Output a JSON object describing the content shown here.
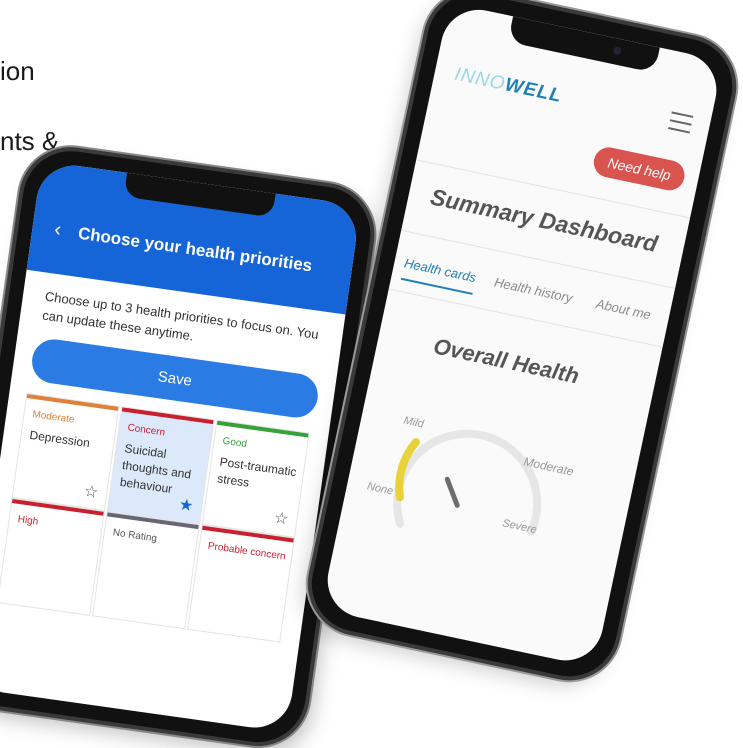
{
  "background": {
    "line1": "ion",
    "line2": "nts &"
  },
  "left_phone": {
    "header": {
      "back_icon": "chevron-left-icon",
      "title": "Choose your health priorities"
    },
    "description": "Choose up to 3 health priorities to focus on. You can update these anytime.",
    "save_label": "Save",
    "cards": [
      {
        "level": "Moderate",
        "name": "Depression",
        "starred": false
      },
      {
        "level": "Concern",
        "name": "Suicidal thoughts and behaviour",
        "starred": true
      },
      {
        "level": "Good",
        "name": "Post-traumatic stress",
        "starred": false
      },
      {
        "level": "High",
        "name": "",
        "starred": false
      },
      {
        "level": "No Rating",
        "name": "",
        "starred": false
      },
      {
        "level": "Probable concern",
        "name": "",
        "starred": false
      }
    ],
    "colors": {
      "header": "#1565d8",
      "moderate": "#e0803a",
      "concern": "#c8202f",
      "good": "#39a13a"
    }
  },
  "right_phone": {
    "logo": {
      "part1": "INNO",
      "part2": "WELL"
    },
    "menu_icon": "hamburger-menu-icon",
    "help_label": "Need help",
    "dashboard_title": "Summary Dashboard",
    "tabs": [
      {
        "label": "Health cards",
        "active": true
      },
      {
        "label": "Health history",
        "active": false
      },
      {
        "label": "About me",
        "active": false
      }
    ],
    "overall_title": "Overall Health",
    "gauge": {
      "labels": {
        "mild": "Mild",
        "moderate": "Moderate",
        "none": "None",
        "severe": "Severe"
      },
      "level_fraction": 0.22
    },
    "colors": {
      "help": "#d9534f",
      "accent": "#1f7fb6",
      "gauge_fill": "#e8d23a"
    }
  }
}
